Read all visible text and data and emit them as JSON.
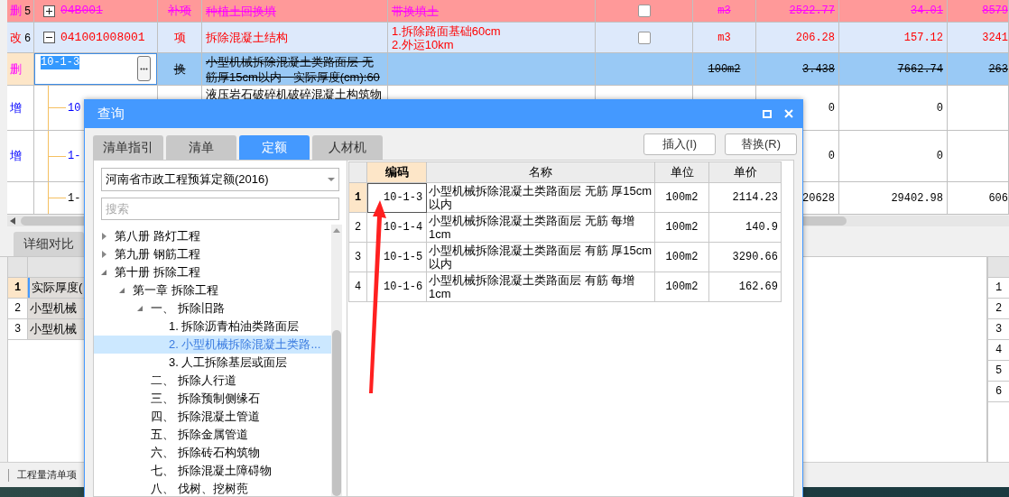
{
  "main_table": {
    "rows": [
      {
        "kind": "deleted",
        "selected": false,
        "editing": false,
        "mark": "删",
        "number": "5",
        "expanded": false,
        "code": "04B001",
        "type": "补项",
        "name": "种植土回换填",
        "feature": [
          "带换填土"
        ],
        "checked": false,
        "unit": "m3",
        "quantity": "2522.77",
        "price": "34.01",
        "total": "8579"
      },
      {
        "kind": "modified",
        "selected": false,
        "editing": false,
        "mark": "改",
        "number": "6",
        "expanded": true,
        "code": "041001008001",
        "type": "项",
        "name": "拆除混凝土结构",
        "feature": [
          "1.拆除路面基础60cm",
          "2.外运10km"
        ],
        "checked": false,
        "unit": "m3",
        "quantity": "206.28",
        "price": "157.12",
        "total": "3241",
        "children": [
          {
            "kind": "deleted",
            "selected": true,
            "editing": true,
            "mark": "删",
            "code": "10-1-3",
            "type": "换",
            "name": "小型机械拆除混凝土类路面层 无筋厚15cm以内　实际厚度(cm):60",
            "unit": "100m2",
            "quantity": "3.438",
            "price": "7662.74",
            "total": "263"
          },
          {
            "kind": "added",
            "selected": false,
            "editing": false,
            "mark": "增",
            "code": "10",
            "name": "液压岩石破碎机破碎混凝土构筑物",
            "quantity": "0",
            "price": "0"
          },
          {
            "kind": "added",
            "selected": false,
            "editing": false,
            "mark": "增",
            "code": "1-",
            "quantity": "0",
            "price": "0"
          },
          {
            "kind": "unchanged",
            "selected": false,
            "editing": false,
            "code": "1-",
            "quantity": "20628",
            "price": "29402.98",
            "total": "606"
          }
        ]
      }
    ]
  },
  "bottom_panel": {
    "tabs": [
      {
        "label": "详细对比",
        "selected": true
      }
    ],
    "detail_rows": [
      {
        "number": "1",
        "text": "实际厚度(",
        "selected": true
      },
      {
        "number": "2",
        "text": "小型机械",
        "selected": false
      },
      {
        "number": "3",
        "text": "小型机械",
        "selected": false
      }
    ],
    "side_rows": [
      "1",
      "2",
      "3",
      "4",
      "5",
      "6"
    ]
  },
  "status_bar": {
    "text": "工程量清单项"
  },
  "dialog": {
    "title": "查询",
    "tabs": [
      {
        "label": "清单指引",
        "selected": false
      },
      {
        "label": "清单",
        "selected": false
      },
      {
        "label": "定额",
        "selected": true
      },
      {
        "label": "人材机",
        "selected": false
      }
    ],
    "buttons": [
      "插入(I)",
      "替换(R)"
    ],
    "library": "河南省市政工程预算定额(2016)",
    "search": {
      "placeholder": "搜索"
    },
    "tree": [
      {
        "label": "第八册 路灯工程",
        "expanded": false,
        "selected": false
      },
      {
        "label": "第九册 钢筋工程",
        "expanded": false,
        "selected": false
      },
      {
        "label": "第十册 拆除工程",
        "expanded": true,
        "selected": false,
        "children": [
          {
            "label": "第一章 拆除工程",
            "expanded": true,
            "selected": false,
            "children": [
              {
                "label": "一、 拆除旧路",
                "expanded": true,
                "selected": false,
                "children": [
                  {
                    "label": "1. 拆除沥青柏油类路面层",
                    "selected": false
                  },
                  {
                    "label": "2. 小型机械拆除混凝土类路...",
                    "selected": true
                  },
                  {
                    "label": "3. 人工拆除基层或面层",
                    "selected": false
                  }
                ]
              },
              {
                "label": "二、 拆除人行道",
                "selected": false
              },
              {
                "label": "三、 拆除预制侧缘石",
                "selected": false
              },
              {
                "label": "四、 拆除混凝土管道",
                "selected": false
              },
              {
                "label": "五、 拆除金属管道",
                "selected": false
              },
              {
                "label": "六、 拆除砖石构筑物",
                "selected": false
              },
              {
                "label": "七、 拆除混凝土障碍物",
                "selected": false
              },
              {
                "label": "八、 伐树、挖树蔸",
                "selected": false
              }
            ]
          }
        ]
      }
    ],
    "results": {
      "columns": [
        "编码",
        "名称",
        "单位",
        "单价"
      ],
      "rows": [
        {
          "number": "1",
          "code": "10-1-3",
          "name": "小型机械拆除混凝土类路面层 无筋 厚15cm以内",
          "unit": "100m2",
          "price": "2114.23",
          "selected": true
        },
        {
          "number": "2",
          "code": "10-1-4",
          "name": "小型机械拆除混凝土类路面层 无筋 每增1cm",
          "unit": "100m2",
          "price": "140.9",
          "selected": false
        },
        {
          "number": "3",
          "code": "10-1-5",
          "name": "小型机械拆除混凝土类路面层 有筋 厚15cm以内",
          "unit": "100m2",
          "price": "3290.66",
          "selected": false
        },
        {
          "number": "4",
          "code": "10-1-6",
          "name": "小型机械拆除混凝土类路面层 有筋 每增1cm",
          "unit": "100m2",
          "price": "162.69",
          "selected": false
        }
      ]
    }
  }
}
